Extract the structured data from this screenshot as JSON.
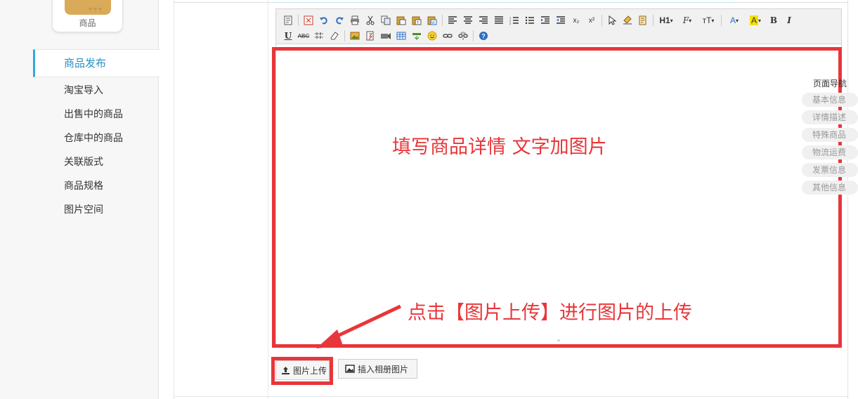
{
  "sidebar": {
    "module_label": "商品",
    "module_stamp": "〒〒〒",
    "items": [
      {
        "label": "商品发布",
        "active": true
      },
      {
        "label": "淘宝导入"
      },
      {
        "label": "出售中的商品"
      },
      {
        "label": "仓库中的商品"
      },
      {
        "label": "关联版式"
      },
      {
        "label": "商品规格"
      },
      {
        "label": "图片空间"
      }
    ]
  },
  "toolbar": {
    "heading_label": "H1",
    "font_label": "F",
    "size_label": "тT",
    "spell_label": "ABC",
    "subscript_label": "x₂",
    "superscript_label": "x²"
  },
  "annotations": {
    "editor_hint": "填写商品详情 文字加图片",
    "upload_hint": "点击【图片上传】进行图片的上传",
    "color": "#e8363a"
  },
  "page_nav": {
    "title": "页面导航",
    "items": [
      "基本信息",
      "详情描述",
      "特殊商品",
      "物流运费",
      "发票信息",
      "其他信息"
    ]
  },
  "buttons": {
    "upload_label": "图片上传",
    "album_label": "插入相册图片"
  },
  "colors": {
    "accent": "#33a8dc",
    "annotation": "#e8363a",
    "module_box": "#d9ab59"
  }
}
